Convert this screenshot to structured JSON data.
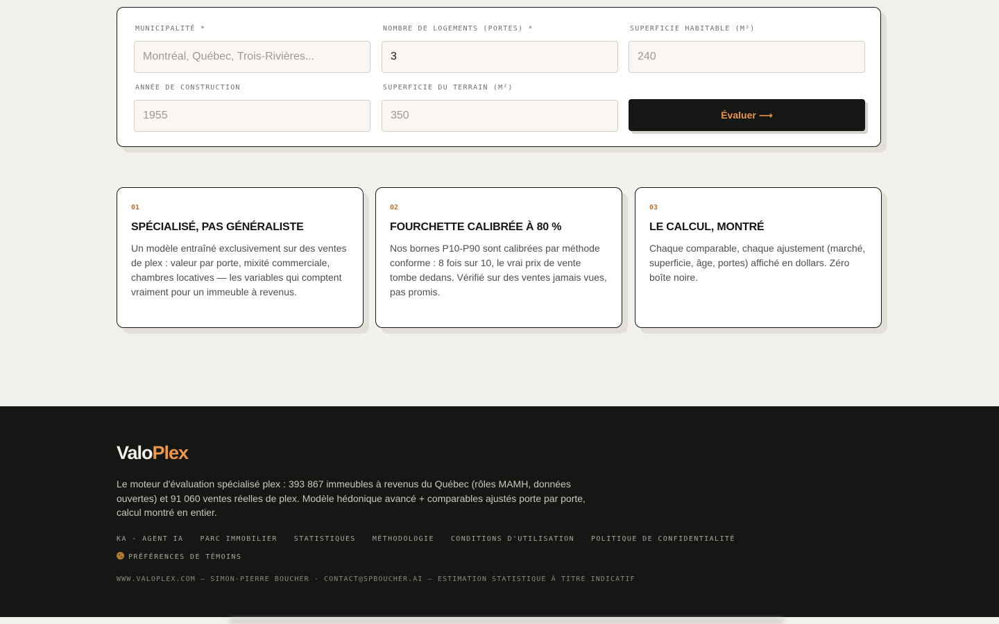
{
  "form": {
    "fields": [
      {
        "label": "MUNICIPALITÉ *",
        "value": "",
        "placeholder": "Montréal, Québec, Trois-Rivières..."
      },
      {
        "label": "NOMBRE DE LOGEMENTS (PORTES) *",
        "value": "3",
        "placeholder": ""
      },
      {
        "label": "SUPERFICIE HABITABLE (M²)",
        "value": "",
        "placeholder": "240"
      },
      {
        "label": "ANNÉE DE CONSTRUCTION",
        "value": "",
        "placeholder": "1955"
      },
      {
        "label": "SUPERFICIE DU TERRAIN (M²)",
        "value": "",
        "placeholder": "350"
      }
    ],
    "submit_label": "Évaluer ⟶"
  },
  "features": [
    {
      "num": "01",
      "title": "SPÉCIALISÉ, PAS GÉNÉRALISTE",
      "text": "Un modèle entraîné exclusivement sur des ventes de plex : valeur par porte, mixité commerciale, chambres locatives — les variables qui comptent vraiment pour un immeuble à revenus."
    },
    {
      "num": "02",
      "title": "FOURCHETTE CALIBRÉE À 80 %",
      "text": "Nos bornes P10-P90 sont calibrées par méthode conforme : 8 fois sur 10, le vrai prix de vente tombe dedans. Vérifié sur des ventes jamais vues, pas promis."
    },
    {
      "num": "03",
      "title": "LE CALCUL, MONTRÉ",
      "text": "Chaque comparable, chaque ajustement (marché, superficie, âge, portes) affiché en dollars. Zéro boîte noire."
    }
  ],
  "footer": {
    "brand_main": "Valo",
    "brand_accent": "Plex",
    "description": "Le moteur d'évaluation spécialisé plex : 393 867 immeubles à revenus du Québec (rôles MAMH, données ouvertes) et 91 060 ventes réelles de plex. Modèle hédonique avancé + comparables ajustés porte par porte, calcul montré en entier.",
    "links": [
      "KA · AGENT IA",
      "PARC IMMOBILIER",
      "STATISTIQUES",
      "MÉTHODOLOGIE",
      "CONDITIONS D'UTILISATION",
      "POLITIQUE DE CONFIDENTIALITÉ"
    ],
    "cookie_prefs": "PRÉFÉRENCES DE TÉMOINS",
    "bottom_line": "WWW.VALOPLEX.COM — SIMON-PIERRE BOUCHER · CONTACT@SPBOUCHER.AI — ESTIMATION STATISTIQUE À TITRE INDICATIF"
  },
  "colors": {
    "accent": "#f0964b",
    "dark": "#141713",
    "background": "#f3f1ec"
  }
}
